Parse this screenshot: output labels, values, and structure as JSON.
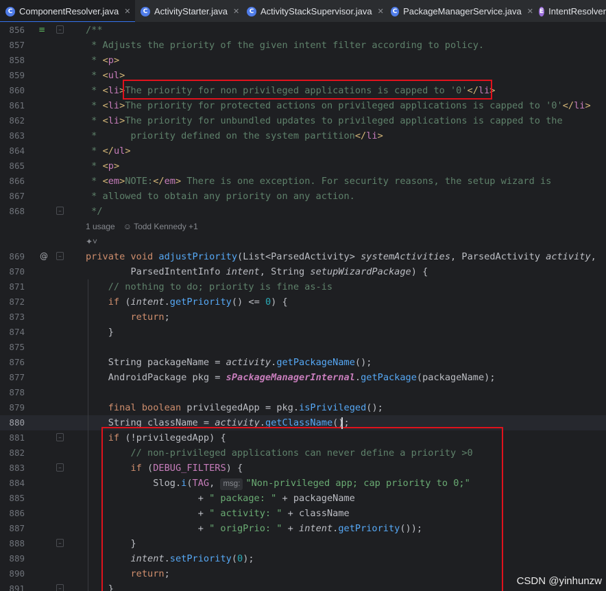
{
  "tabs": [
    {
      "label": "ComponentResolver.java",
      "icon": "class-icon",
      "active": true
    },
    {
      "label": "ActivityStarter.java",
      "icon": "class-icon",
      "active": false
    },
    {
      "label": "ActivityStackSupervisor.java",
      "icon": "class-icon",
      "active": false
    },
    {
      "label": "PackageManagerService.java",
      "icon": "class-icon",
      "active": false
    },
    {
      "label": "IntentResolver",
      "icon": "enum-class-icon",
      "active": false
    }
  ],
  "inlay": {
    "usages": "1 usage",
    "author": "Todd Kennedy +1"
  },
  "hint_msg": "msg:",
  "lines": [
    {
      "n": "856",
      "code": "/**"
    },
    {
      "n": "857",
      "code": " * Adjusts the priority of the given intent filter according to policy."
    },
    {
      "n": "858",
      "code": " * <p>"
    },
    {
      "n": "859",
      "code": " * <ul>"
    },
    {
      "n": "860",
      "code": " * <li>The priority for non privileged applications is capped to '0'</li>"
    },
    {
      "n": "861",
      "code": " * <li>The priority for protected actions on privileged applications is capped to '0'</li>"
    },
    {
      "n": "862",
      "code": " * <li>The priority for unbundled updates to privileged applications is capped to the"
    },
    {
      "n": "863",
      "code": " *      priority defined on the system partition</li>"
    },
    {
      "n": "864",
      "code": " * </ul>"
    },
    {
      "n": "865",
      "code": " * <p>"
    },
    {
      "n": "866",
      "code": " * <em>NOTE:</em> There is one exception. For security reasons, the setup wizard is"
    },
    {
      "n": "867",
      "code": " * allowed to obtain any priority on any action."
    },
    {
      "n": "868",
      "code": " */"
    },
    {
      "n": "869",
      "code": "private void adjustPriority(List<ParsedActivity> systemActivities, ParsedActivity activity,"
    },
    {
      "n": "870",
      "code": "        ParsedIntentInfo intent, String setupWizardPackage) {"
    },
    {
      "n": "871",
      "code": "    // nothing to do; priority is fine as-is"
    },
    {
      "n": "872",
      "code": "    if (intent.getPriority() <= 0) {"
    },
    {
      "n": "873",
      "code": "        return;"
    },
    {
      "n": "874",
      "code": "    }"
    },
    {
      "n": "875",
      "code": ""
    },
    {
      "n": "876",
      "code": "    String packageName = activity.getPackageName();"
    },
    {
      "n": "877",
      "code": "    AndroidPackage pkg = sPackageManagerInternal.getPackage(packageName);"
    },
    {
      "n": "878",
      "code": ""
    },
    {
      "n": "879",
      "code": "    final boolean privilegedApp = pkg.isPrivileged();"
    },
    {
      "n": "880",
      "code": "    String className = activity.getClassName();"
    },
    {
      "n": "881",
      "code": "    if (!privilegedApp) {"
    },
    {
      "n": "882",
      "code": "        // non-privileged applications can never define a priority >0"
    },
    {
      "n": "883",
      "code": "        if (DEBUG_FILTERS) {"
    },
    {
      "n": "884",
      "code": "            Slog.i(TAG, \"Non-privileged app; cap priority to 0;\""
    },
    {
      "n": "885",
      "code": "                    + \" package: \" + packageName"
    },
    {
      "n": "886",
      "code": "                    + \" activity: \" + className"
    },
    {
      "n": "887",
      "code": "                    + \" origPrio: \" + intent.getPriority());"
    },
    {
      "n": "888",
      "code": "        }"
    },
    {
      "n": "889",
      "code": "        intent.setPriority(0);"
    },
    {
      "n": "890",
      "code": "        return;"
    },
    {
      "n": "891",
      "code": "    }"
    }
  ],
  "watermark": "CSDN @yinhunzw",
  "colors": {
    "highlight_box": "#e0121c",
    "active_tab_underline": "#3574f0",
    "background": "#1e1f22"
  }
}
